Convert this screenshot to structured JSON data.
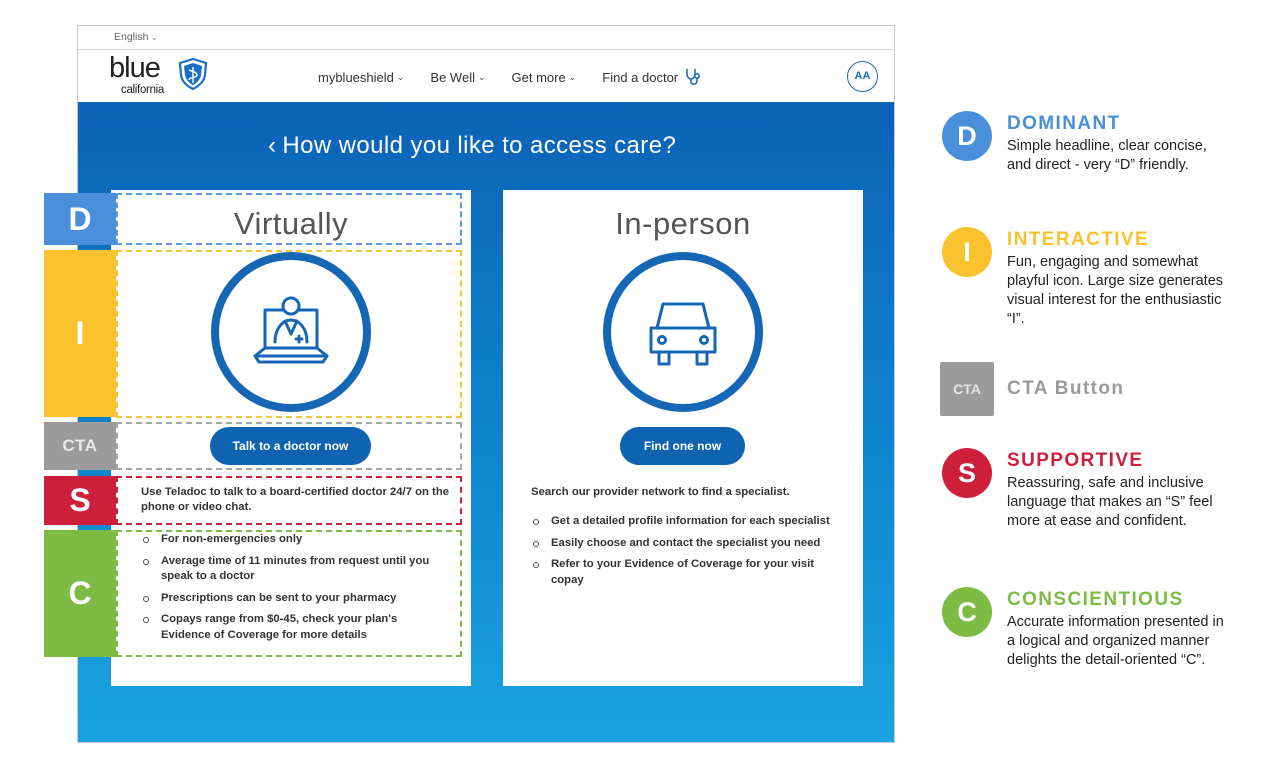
{
  "site": {
    "language": "English",
    "logo": {
      "word": "blue",
      "region": "california",
      "shield_icon": "shield-caduceus-icon"
    },
    "nav": [
      {
        "label": "myblueshield",
        "has_dropdown": true
      },
      {
        "label": "Be Well",
        "has_dropdown": true
      },
      {
        "label": "Get more",
        "has_dropdown": true
      },
      {
        "label": "Find a doctor",
        "icon": "stethoscope-icon"
      }
    ],
    "text_size_button": "AA",
    "colors": {
      "brand_blue": "#0f63b1",
      "hero_top": "#0b62b7",
      "hero_bottom": "#1aa3e0"
    }
  },
  "main": {
    "heading": "How would you like to access care?",
    "cards": [
      {
        "title": "Virtually",
        "icon": "telehealth-doctor-laptop-icon",
        "button": "Talk to a doctor now",
        "description": "Use Teladoc to talk to a board-certified doctor 24/7 on the phone or video chat.",
        "bullets": [
          "For non-emergencies only",
          "Average time of 11 minutes from request until you speak to a doctor",
          "Prescriptions can be sent to your pharmacy",
          "Copays range from $0-45, check your plan's Evidence of Coverage for more details"
        ]
      },
      {
        "title": "In-person",
        "icon": "car-icon",
        "button": "Find one now",
        "description": "Search our provider network to find a specialist.",
        "bullets": [
          "Get a detailed profile information for each specialist",
          "Easily choose and contact the specialist you need",
          "Refer to your Evidence of Coverage for your visit copay"
        ]
      }
    ]
  },
  "overlay_tags": {
    "d": "D",
    "i": "I",
    "cta": "CTA",
    "s": "S",
    "c": "C"
  },
  "legend": [
    {
      "badge": "D",
      "title": "DOMINANT",
      "color": "#4a8fd9",
      "text": "Simple headline, clear concise, and direct - very “D” friendly."
    },
    {
      "badge": "I",
      "title": "INTERACTIVE",
      "color": "#fbc22e",
      "text": "Fun, engaging and somewhat playful icon. Large size generates visual interest for the enthusiastic “I”."
    },
    {
      "badge": "CTA",
      "title": "CTA Button",
      "color": "#9b9b9b",
      "text": ""
    },
    {
      "badge": "S",
      "title": "SUPPORTIVE",
      "color": "#cd1f3b",
      "text": "Reassuring, safe and inclusive language that makes an “S” feel more at ease and confident."
    },
    {
      "badge": "C",
      "title": "CONSCIENTIOUS",
      "color": "#7dbb45",
      "text": "Accurate information presented in a logical and organized manner delights the detail-oriented “C”."
    }
  ]
}
